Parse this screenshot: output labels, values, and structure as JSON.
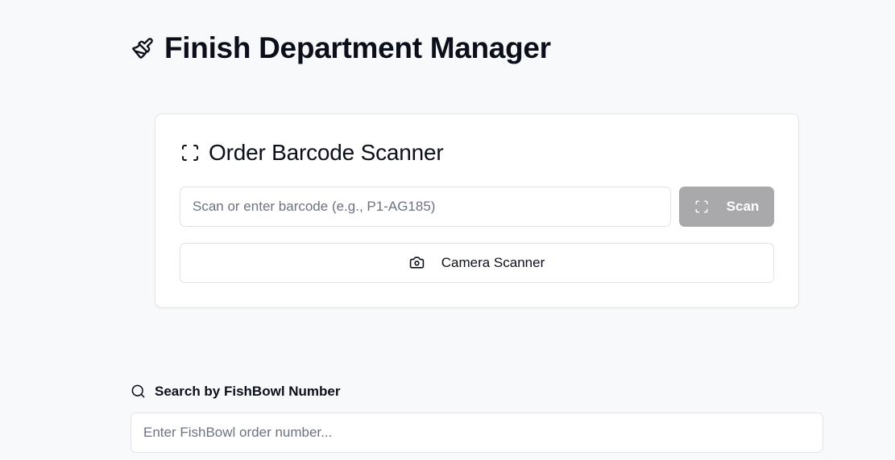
{
  "header": {
    "title": "Finish Department Manager",
    "icon": "paintbrush-icon"
  },
  "scanner_card": {
    "title": "Order Barcode Scanner",
    "title_icon": "scan-frame-icon",
    "barcode_input": {
      "value": "",
      "placeholder": "Scan or enter barcode (e.g., P1-AG185)"
    },
    "scan_button": {
      "label": "Scan",
      "icon": "scan-frame-icon",
      "state": "disabled",
      "color": "#a9a9ab"
    },
    "camera_button": {
      "label": "Camera Scanner",
      "icon": "camera-icon"
    }
  },
  "fishbowl_search": {
    "label": "Search by FishBowl Number",
    "icon": "search-icon",
    "input": {
      "value": "",
      "placeholder": "Enter FishBowl order number..."
    }
  },
  "colors": {
    "background": "#f8f9fb",
    "card": "#ffffff",
    "border": "#dfe2e7",
    "text": "#0b0f19",
    "placeholder": "#6b7280"
  }
}
